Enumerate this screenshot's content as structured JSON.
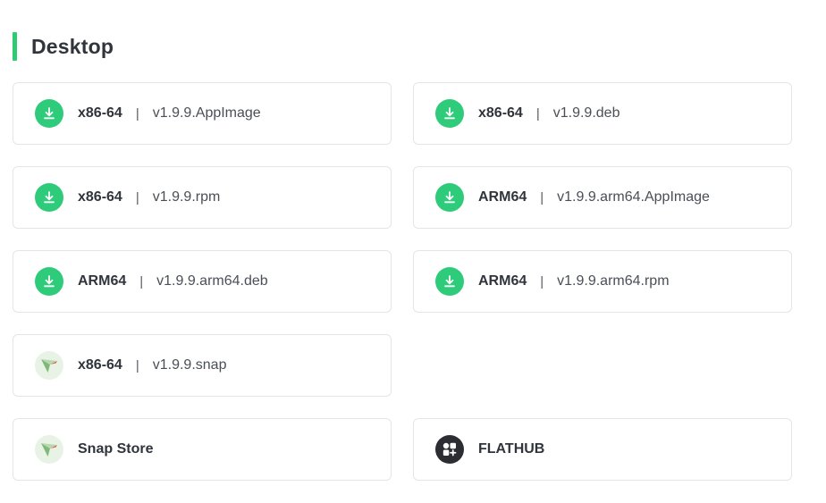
{
  "section": {
    "title": "Desktop"
  },
  "colors": {
    "accent": "#2ecc71",
    "download_icon": "#2ecc7a",
    "flathub_icon": "#2b2d33"
  },
  "downloads": [
    {
      "arch": "x86-64",
      "separator": "|",
      "file": "v1.9.9.AppImage",
      "icon": "download-icon"
    },
    {
      "arch": "x86-64",
      "separator": "|",
      "file": "v1.9.9.deb",
      "icon": "download-icon"
    },
    {
      "arch": "x86-64",
      "separator": "|",
      "file": "v1.9.9.rpm",
      "icon": "download-icon"
    },
    {
      "arch": "ARM64",
      "separator": "|",
      "file": "v1.9.9.arm64.AppImage",
      "icon": "download-icon"
    },
    {
      "arch": "ARM64",
      "separator": "|",
      "file": "v1.9.9.arm64.deb",
      "icon": "download-icon"
    },
    {
      "arch": "ARM64",
      "separator": "|",
      "file": "v1.9.9.arm64.rpm",
      "icon": "download-icon"
    },
    {
      "arch": "x86-64",
      "separator": "|",
      "file": "v1.9.9.snap",
      "icon": "snapcraft-icon"
    }
  ],
  "stores": [
    {
      "label": "Snap Store",
      "icon": "snapcraft-icon"
    },
    {
      "label": "FLATHUB",
      "icon": "flathub-icon"
    }
  ]
}
